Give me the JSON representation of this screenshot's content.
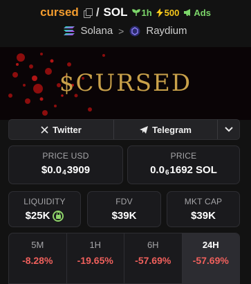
{
  "header": {
    "token_name": "cursed",
    "slash": "/",
    "quote": "SOL",
    "badges": [
      {
        "icon": "sprout-icon",
        "label": "1h",
        "color": "#7cd66a"
      },
      {
        "icon": "lightning-icon",
        "label": "500",
        "color": "#f5c61b"
      },
      {
        "icon": "megaphone-icon",
        "label": "Ads",
        "color": "#7cd66a"
      }
    ],
    "chain": "Solana",
    "dex": "Raydium"
  },
  "banner": {
    "text": "$CURSED"
  },
  "social": {
    "twitter_label": "Twitter",
    "telegram_label": "Telegram"
  },
  "price_usd": {
    "label": "PRICE USD",
    "prefix": "$0.0",
    "zeros": "4",
    "digits": "3909"
  },
  "price_sol": {
    "label": "PRICE",
    "prefix": "0.0",
    "zeros": "6",
    "digits": "1692 SOL"
  },
  "liquidity": {
    "label": "LIQUIDITY",
    "value": "$25K"
  },
  "fdv": {
    "label": "FDV",
    "value": "$39K"
  },
  "mkt_cap": {
    "label": "MKT CAP",
    "value": "$39K"
  },
  "changes": [
    {
      "label": "5M",
      "value": "-8.28%"
    },
    {
      "label": "1H",
      "value": "-19.65%"
    },
    {
      "label": "6H",
      "value": "-57.69%"
    },
    {
      "label": "24H",
      "value": "-57.69%",
      "active": true
    }
  ],
  "colors": {
    "accent": "#f39c2e",
    "negative": "#f0605c",
    "positive": "#7cd66a"
  }
}
